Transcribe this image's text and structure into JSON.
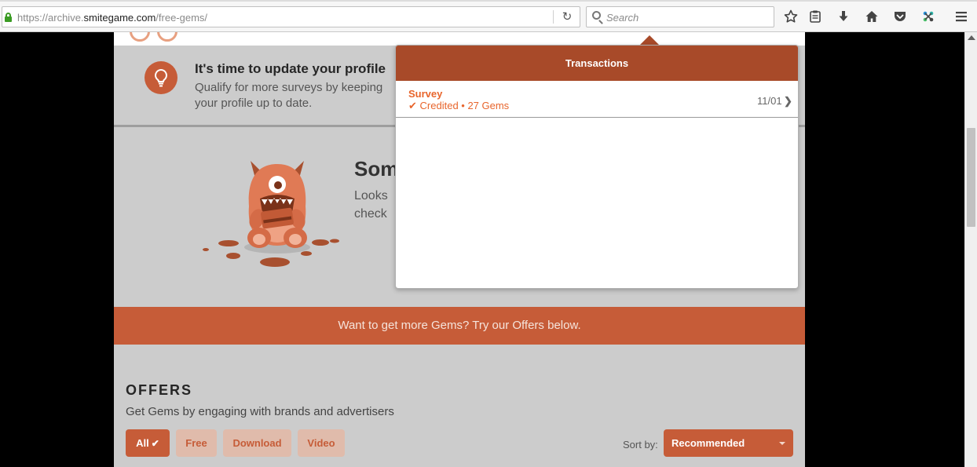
{
  "browser": {
    "url_prefix": "https://archive.",
    "url_host": "smitegame.com",
    "url_path": "/free-gems/",
    "reload_icon": "reload-icon",
    "search_placeholder": "Search",
    "toolbar_icons": [
      "star-icon",
      "reader-icon",
      "download-icon",
      "home-icon",
      "pocket-icon",
      "extension-icon",
      "menu-icon"
    ]
  },
  "profile": {
    "title": "It's time to update your profile",
    "body": "Qualify for more surveys by keeping your profile up to date."
  },
  "notice": {
    "title": "Som",
    "body_line1": "Looks",
    "body_line2": "check"
  },
  "cta": {
    "text": "Want to get more Gems? Try our Offers below."
  },
  "offers": {
    "title": "OFFERS",
    "subtitle": "Get Gems by engaging with brands and advertisers",
    "filters": [
      {
        "label": "All",
        "active": true
      },
      {
        "label": "Free",
        "active": false
      },
      {
        "label": "Download",
        "active": false
      },
      {
        "label": "Video",
        "active": false
      }
    ],
    "sort_label": "Sort by:",
    "sort_value": "Recommended"
  },
  "transactions": {
    "header": "Transactions",
    "items": [
      {
        "type": "Survey",
        "status": "Credited • 27 Gems",
        "date": "11/01"
      }
    ]
  },
  "colors": {
    "brand": "#c65c38",
    "popup_header": "#a84a29",
    "accent_text": "#e8652c"
  }
}
